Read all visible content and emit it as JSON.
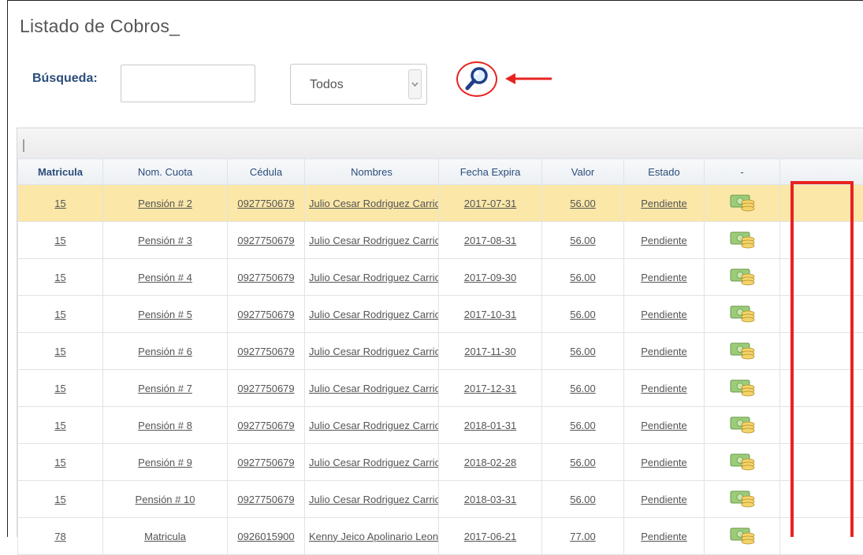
{
  "page": {
    "title": "Listado de Cobros_"
  },
  "search": {
    "label": "Búsqueda:",
    "value": "",
    "placeholder": "",
    "filter_selected": "Todos"
  },
  "icons": {
    "search": "magnifier-icon",
    "dropdown": "chevron-down-icon",
    "pay": "money-coins-icon",
    "annotation": "red-arrow-annotation"
  },
  "colors": {
    "header_text": "#2b4d7a",
    "selected_row": "#fbe7a8",
    "annotation": "#e8231f"
  },
  "table": {
    "columns": [
      "Matricula",
      "Nom. Cuota",
      "Cédula",
      "Nombres",
      "Fecha Expira",
      "Valor",
      "Estado",
      "-"
    ],
    "rows": [
      {
        "matricula": "15",
        "cuota": "Pensión # 2",
        "cedula": "0927750679",
        "nombres": "Julio Cesar Rodriguez Carrion",
        "fecha": "2017-07-31",
        "valor": "56.00",
        "estado": "Pendiente",
        "selected": true
      },
      {
        "matricula": "15",
        "cuota": "Pensión # 3",
        "cedula": "0927750679",
        "nombres": "Julio Cesar Rodriguez Carrion",
        "fecha": "2017-08-31",
        "valor": "56.00",
        "estado": "Pendiente"
      },
      {
        "matricula": "15",
        "cuota": "Pensión # 4",
        "cedula": "0927750679",
        "nombres": "Julio Cesar Rodriguez Carrion",
        "fecha": "2017-09-30",
        "valor": "56.00",
        "estado": "Pendiente"
      },
      {
        "matricula": "15",
        "cuota": "Pensión # 5",
        "cedula": "0927750679",
        "nombres": "Julio Cesar Rodriguez Carrion",
        "fecha": "2017-10-31",
        "valor": "56.00",
        "estado": "Pendiente"
      },
      {
        "matricula": "15",
        "cuota": "Pensión # 6",
        "cedula": "0927750679",
        "nombres": "Julio Cesar Rodriguez Carrion",
        "fecha": "2017-11-30",
        "valor": "56.00",
        "estado": "Pendiente"
      },
      {
        "matricula": "15",
        "cuota": "Pensión # 7",
        "cedula": "0927750679",
        "nombres": "Julio Cesar Rodriguez Carrion",
        "fecha": "2017-12-31",
        "valor": "56.00",
        "estado": "Pendiente"
      },
      {
        "matricula": "15",
        "cuota": "Pensión # 8",
        "cedula": "0927750679",
        "nombres": "Julio Cesar Rodriguez Carrion",
        "fecha": "2018-01-31",
        "valor": "56.00",
        "estado": "Pendiente"
      },
      {
        "matricula": "15",
        "cuota": "Pensión # 9",
        "cedula": "0927750679",
        "nombres": "Julio Cesar Rodriguez Carrion",
        "fecha": "2018-02-28",
        "valor": "56.00",
        "estado": "Pendiente"
      },
      {
        "matricula": "15",
        "cuota": "Pensión # 10",
        "cedula": "0927750679",
        "nombres": "Julio Cesar Rodriguez Carrion",
        "fecha": "2018-03-31",
        "valor": "56.00",
        "estado": "Pendiente"
      },
      {
        "matricula": "78",
        "cuota": "Matricula",
        "cedula": "0926015900",
        "nombres": "Kenny Jeico Apolinario Leon",
        "fecha": "2017-06-21",
        "valor": "77.00",
        "estado": "Pendiente"
      }
    ]
  }
}
